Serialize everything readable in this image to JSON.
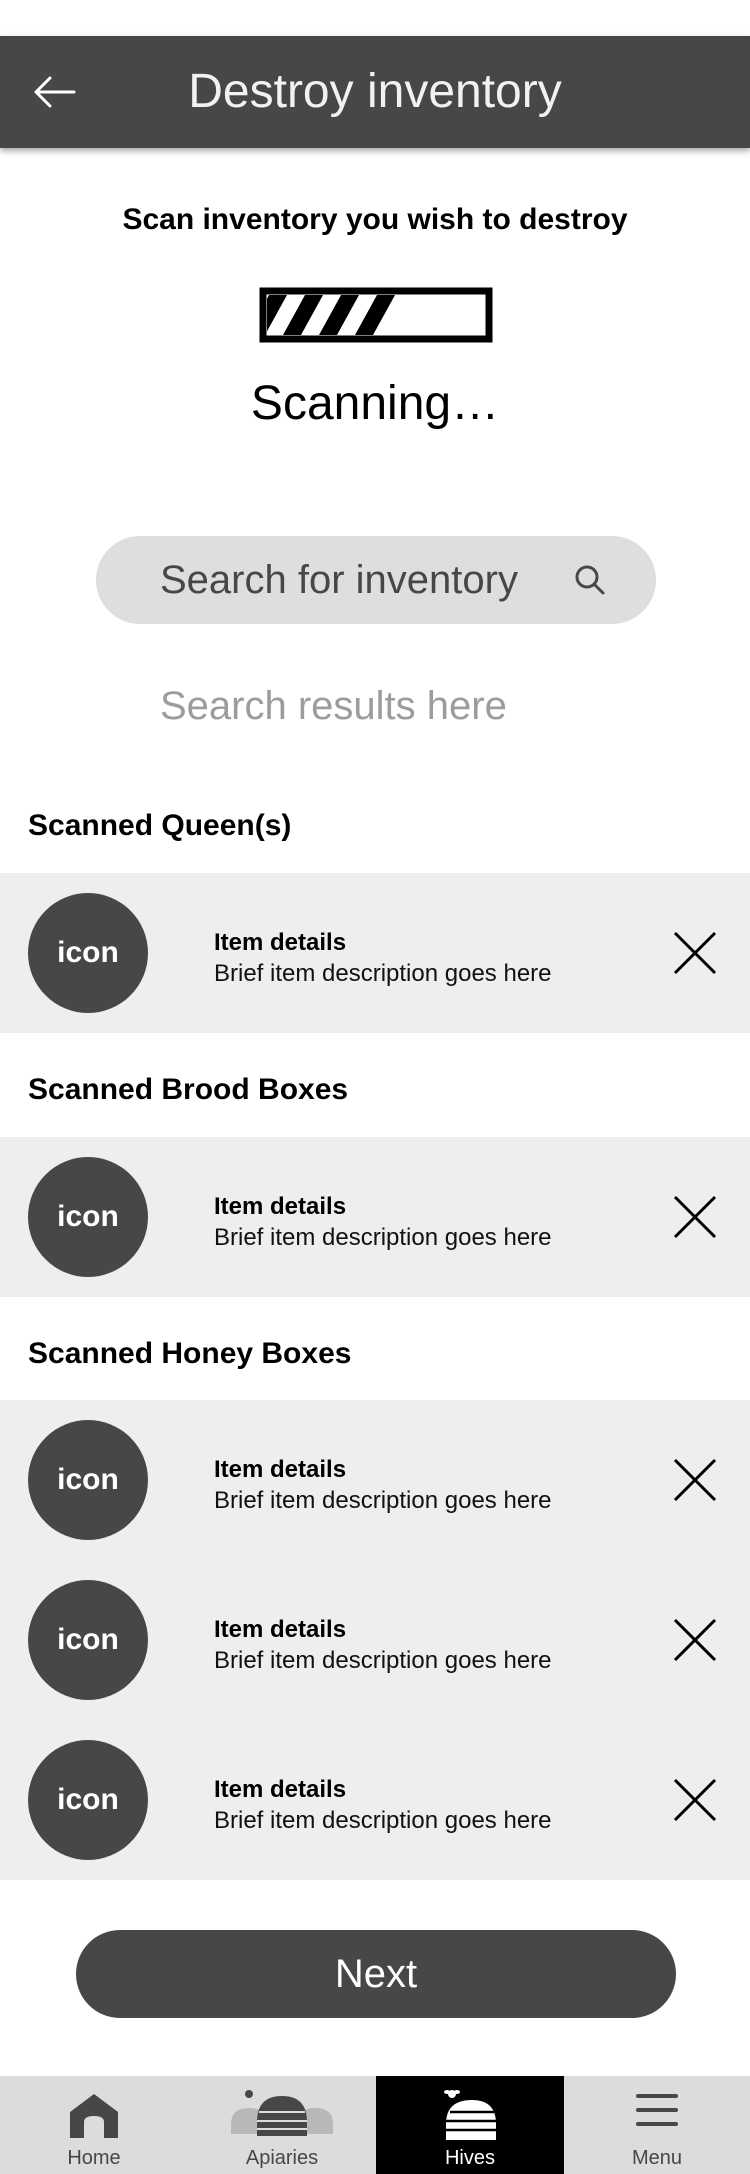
{
  "header": {
    "title": "Destroy inventory",
    "back_icon": "arrow-left-icon"
  },
  "scan": {
    "instruction": "Scan inventory you wish to destroy",
    "status": "Scanning…",
    "progress_fraction": 0.5
  },
  "search": {
    "placeholder": "Search for inventory",
    "value": "",
    "icon": "search-icon",
    "results_hint": "Search results here"
  },
  "sections": [
    {
      "title": "Scanned Queen(s)",
      "items": [
        {
          "icon_text": "icon",
          "title": "Item details",
          "description": "Brief item description goes here"
        }
      ]
    },
    {
      "title": "Scanned Brood Boxes",
      "items": [
        {
          "icon_text": "icon",
          "title": "Item details",
          "description": "Brief item description goes here"
        }
      ]
    },
    {
      "title": "Scanned Honey Boxes",
      "items": [
        {
          "icon_text": "icon",
          "title": "Item details",
          "description": "Brief item description goes here"
        },
        {
          "icon_text": "icon",
          "title": "Item details",
          "description": "Brief item description goes here"
        },
        {
          "icon_text": "icon",
          "title": "Item details",
          "description": "Brief item description goes here"
        }
      ]
    }
  ],
  "next_button": {
    "label": "Next"
  },
  "nav": {
    "active": "Hives",
    "items": [
      {
        "label": "Home",
        "icon": "home-icon"
      },
      {
        "label": "Apiaries",
        "icon": "apiaries-icon"
      },
      {
        "label": "Hives",
        "icon": "beehive-icon"
      },
      {
        "label": "Menu",
        "icon": "hamburger-menu-icon"
      }
    ]
  },
  "colors": {
    "primary": "#474747",
    "row_background": "#eeeeee",
    "search_background": "#dedede",
    "nav_background": "#dcdcdc",
    "nav_active": "#000000",
    "hint_text": "#9c9c9c"
  }
}
